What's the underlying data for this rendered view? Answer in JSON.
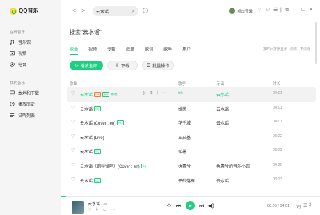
{
  "app": {
    "name": "QQ音乐"
  },
  "sidebar": {
    "sections": [
      {
        "title": "在线音乐",
        "items": [
          "音乐馆",
          "视频",
          "电台"
        ]
      },
      {
        "title": "我的音乐",
        "items": [
          "本地和下载",
          "播放历史",
          "试听列表"
        ]
      }
    ]
  },
  "topbar": {
    "back": "<",
    "forward": ">",
    "search_value": "云水谣",
    "clear": "✕",
    "login": "点击登录"
  },
  "main": {
    "search_title": "搜索\"云水谣\"",
    "tabs": [
      "歌曲",
      "视频",
      "专辑",
      "歌单",
      "歌词",
      "歌手",
      "用户"
    ],
    "active_tab": 0,
    "options": [
      "按时间排序显示",
      "清除",
      "不清除"
    ],
    "play_all": "播放全部",
    "download": "下载",
    "batch": "批量操作",
    "columns": {
      "song": "歌曲",
      "singer": "歌手",
      "album": "专辑",
      "duration": "时长"
    },
    "rows": [
      {
        "title": "云水谣",
        "tags": [
          "VIP",
          "MV"
        ],
        "extra": "原唱",
        "singer": "en",
        "album": "云水谣",
        "duration": "04:01",
        "highlight": true
      },
      {
        "title": "云水谣",
        "tags": [
          "SQ"
        ],
        "extra": "",
        "singer": "婵菌",
        "album": "云水谣",
        "duration": "04:01",
        "highlight": false
      },
      {
        "title": "云水谣 (Cover : en)",
        "tags": [
          "HQ"
        ],
        "extra": "",
        "singer": "花千城",
        "album": "云水谣",
        "duration": "04:01",
        "highlight": false
      },
      {
        "title": "云水谣 (Live)",
        "tags": [],
        "extra": "",
        "singer": "王启基",
        "album": "",
        "duration": "03:22",
        "highlight": false
      },
      {
        "title": "云水谣",
        "tags": [
          "SQ"
        ],
        "extra": "",
        "singer": "松愚",
        "album": "",
        "duration": "03:23",
        "highlight": false
      },
      {
        "title": "云水谣（钢琴弹唱）(Cover : en)",
        "tags": [
          "SQ"
        ],
        "extra": "",
        "singer": "执素兮",
        "album": "执素兮的音乐小馆",
        "duration": "04:20",
        "highlight": false
      },
      {
        "title": "云水谣",
        "tags": [
          "SQ"
        ],
        "extra": "",
        "singer": "平砂落雁",
        "album": "云水谣",
        "duration": "03:23",
        "highlight": false
      }
    ]
  },
  "player": {
    "title": "云水谣",
    "subtitle": " - en",
    "time": "00:05 / 04:01",
    "playlist_count": "2",
    "progress_fraction": 0.02
  },
  "colors": {
    "accent": "#1ecf81",
    "vip": "#ff7a2e"
  }
}
